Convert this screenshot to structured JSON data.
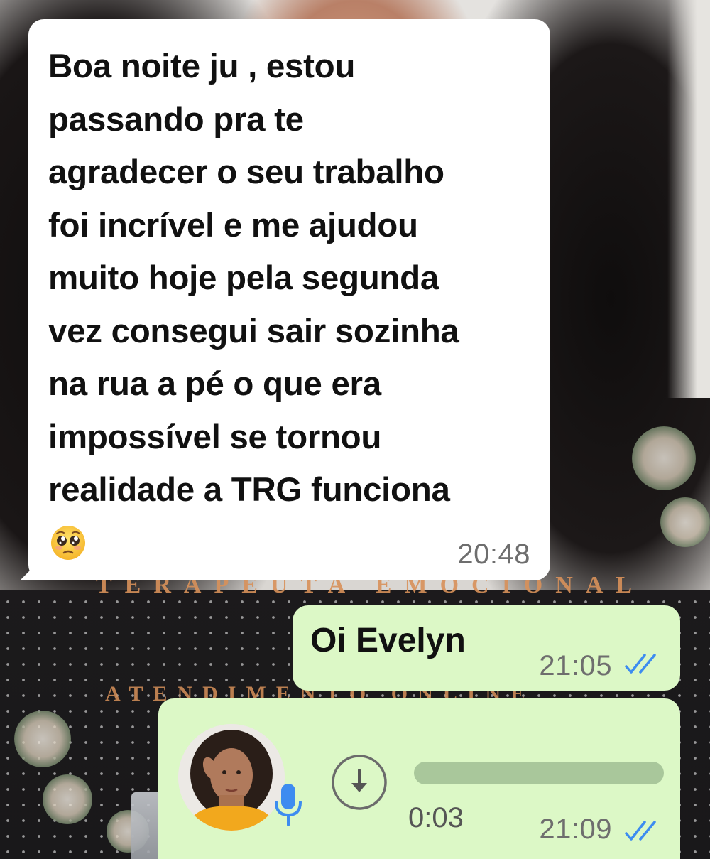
{
  "chat": {
    "incoming": {
      "text": "Boa noite ju , estou\npassando pra te\nagradecer o seu trabalho\nfoi incrível e me ajudou\nmuito hoje pela segunda\nvez consegui sair sozinha\nna rua a pé o que era\nimpossível se tornou\nrealidade a TRG funciona",
      "emoji": "pleading-face-emoji",
      "time": "20:48"
    },
    "outgoing_text": {
      "text": "Oi Evelyn",
      "time": "21:05",
      "status_icon": "double-check-read-icon"
    },
    "outgoing_audio": {
      "duration": "0:03",
      "time": "21:09",
      "progress": 0,
      "status_icon": "double-check-read-icon",
      "download_icon": "download-arrow-icon",
      "mic_icon": "microphone-icon"
    }
  },
  "wallpaper": {
    "line1": "TERAPEUTA EMOCIONAL",
    "line2": "ATENDIMENTO ONLINE"
  },
  "colors": {
    "incoming_bubble": "#ffffff",
    "outgoing_bubble": "#dcf8c6",
    "read_ticks": "#3d8cf0",
    "mic": "#3d8cf0",
    "wall_text": "#d8915a"
  }
}
